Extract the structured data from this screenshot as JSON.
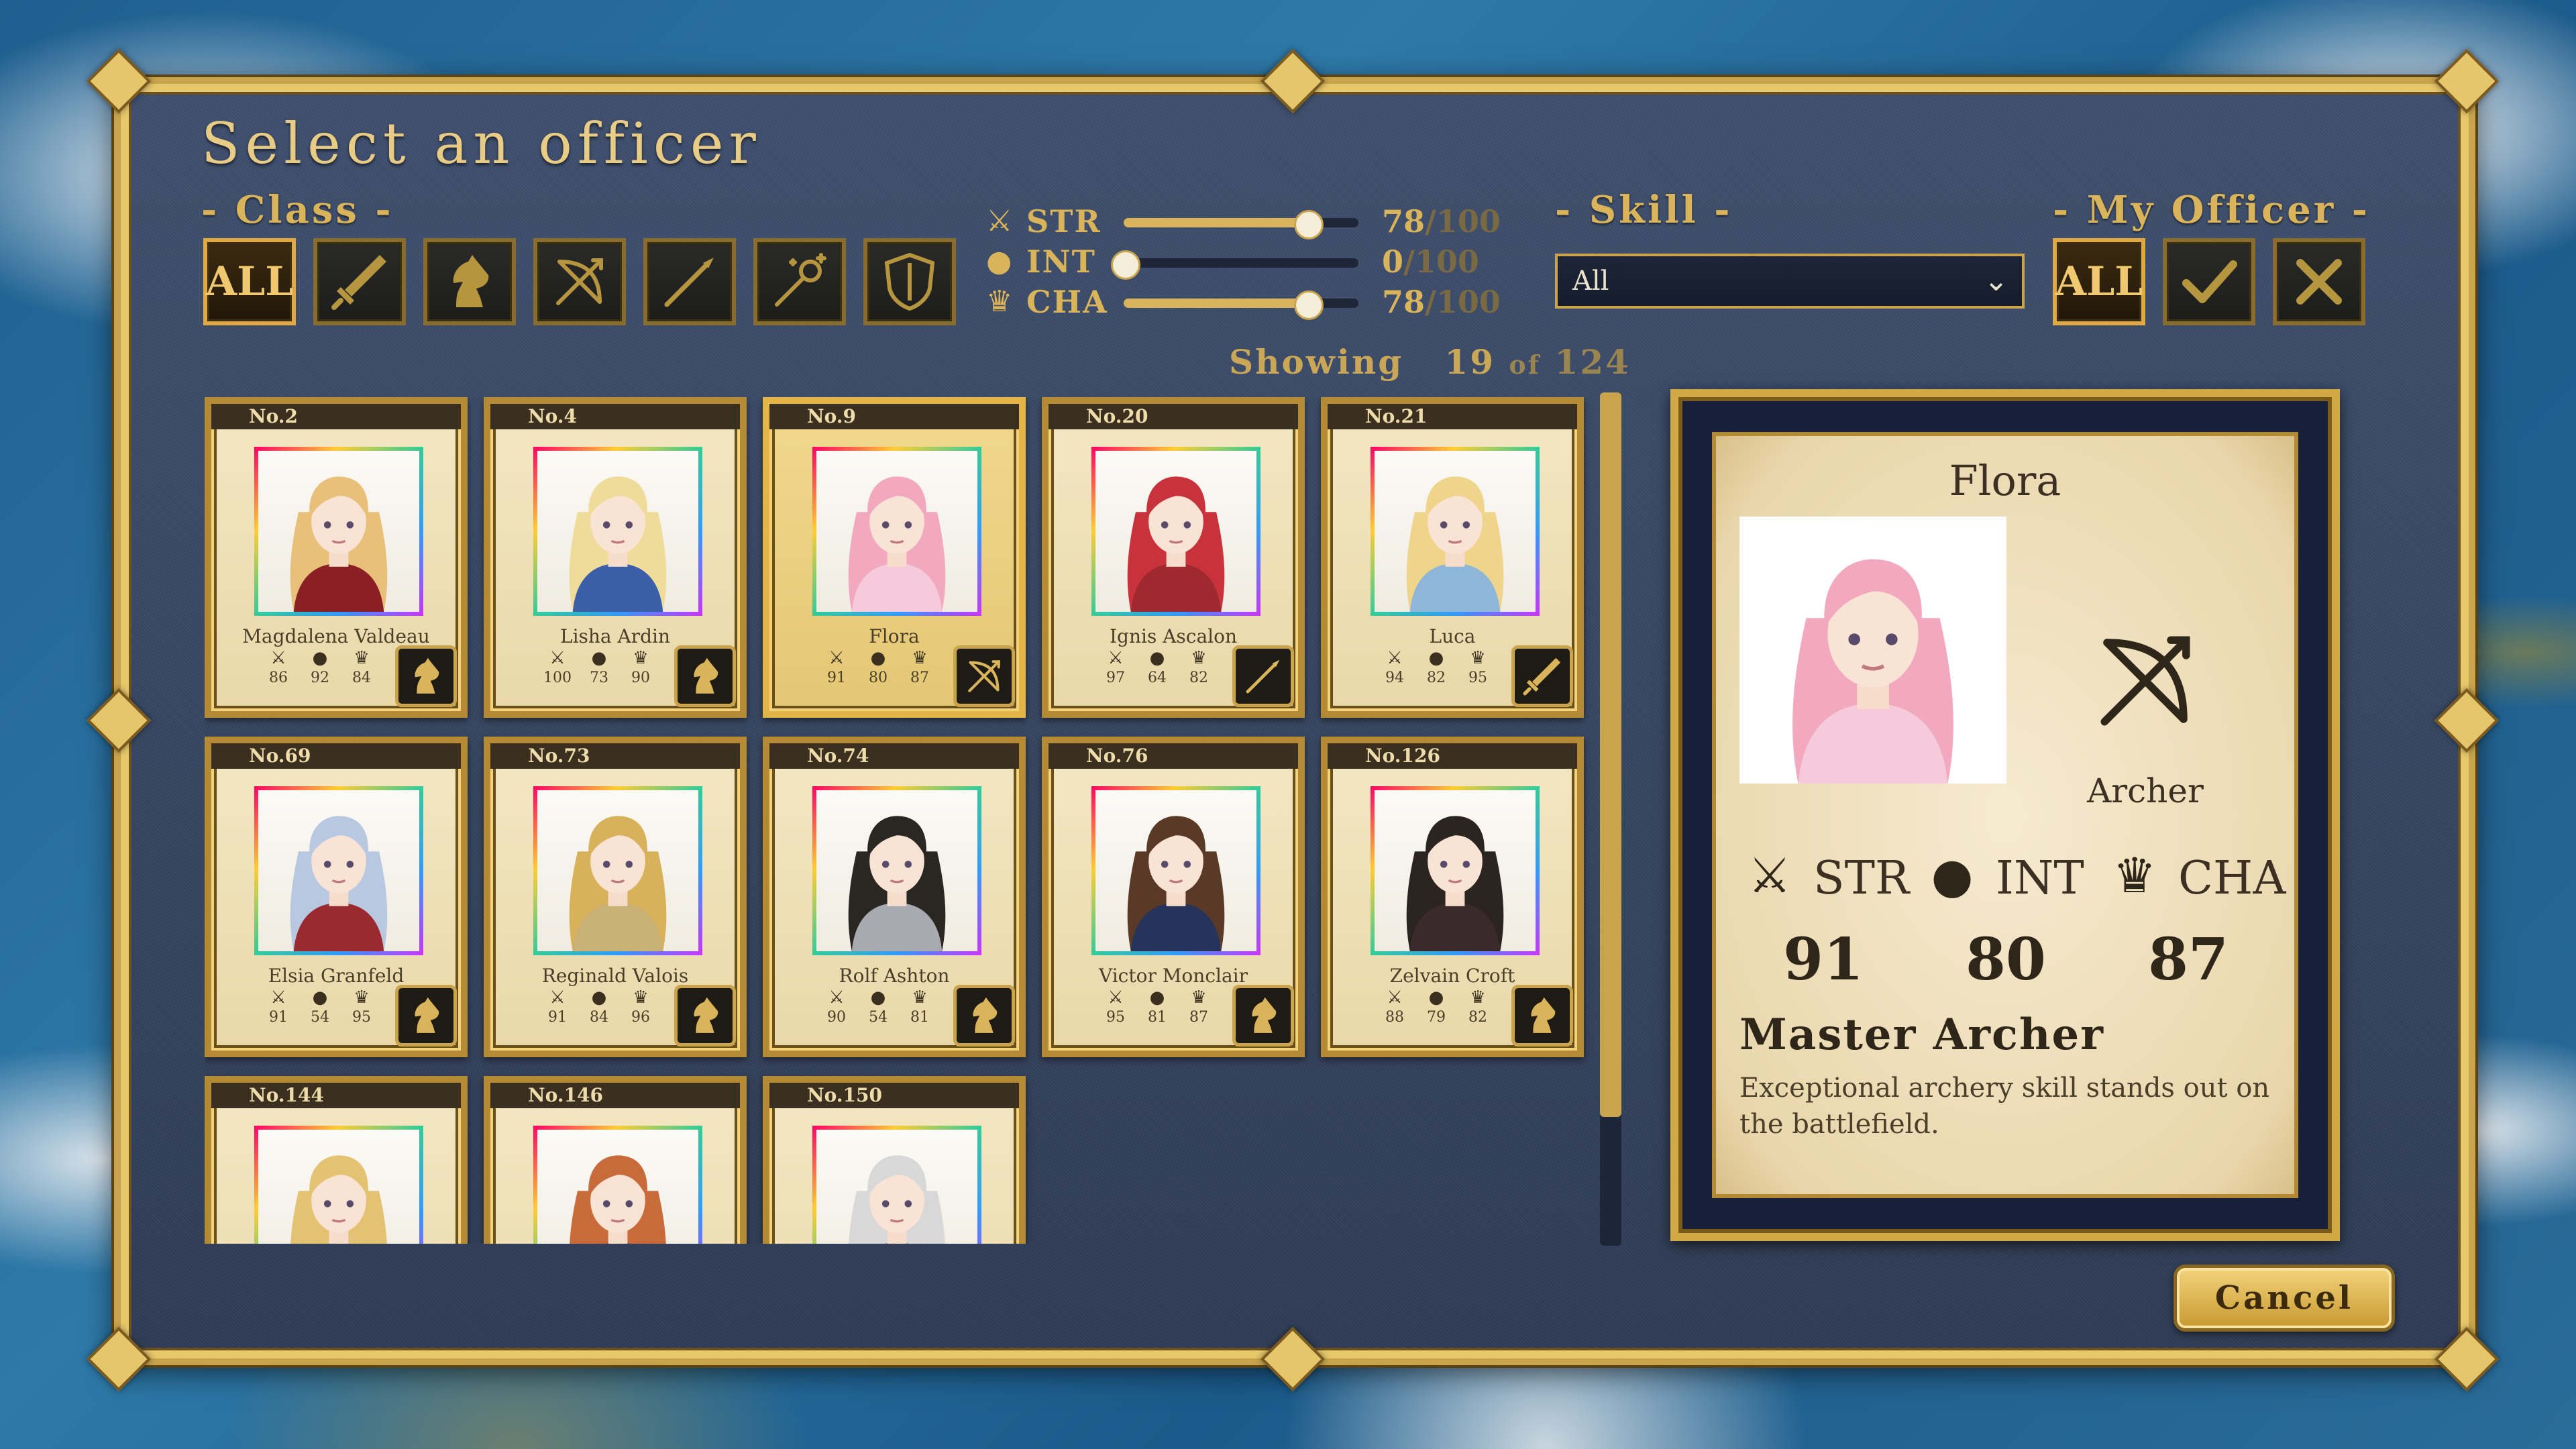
{
  "title": "Select an officer",
  "class_filter": {
    "label": "- Class -",
    "buttons": [
      {
        "label": "ALL",
        "icon": "all-text",
        "active": true
      },
      {
        "label": "",
        "icon": "sword-icon",
        "active": false
      },
      {
        "label": "",
        "icon": "knight-horse-icon",
        "active": false
      },
      {
        "label": "",
        "icon": "bow-icon",
        "active": false
      },
      {
        "label": "",
        "icon": "spear-icon",
        "active": false
      },
      {
        "label": "",
        "icon": "magic-staff-icon",
        "active": false
      },
      {
        "label": "",
        "icon": "shield-icon",
        "active": false
      }
    ]
  },
  "stat_sliders": [
    {
      "name": "STR",
      "icon": "sword-icon",
      "value": 78,
      "max": "100",
      "slash": "/"
    },
    {
      "name": "INT",
      "icon": "orb-icon",
      "value": 0,
      "max": "100",
      "slash": "/"
    },
    {
      "name": "CHA",
      "icon": "crown-icon",
      "value": 78,
      "max": "100",
      "slash": "/"
    }
  ],
  "skill_filter": {
    "label": "- Skill -",
    "selected": "All"
  },
  "my_officer_filter": {
    "label": "- My Officer -",
    "buttons": [
      {
        "label": "ALL",
        "icon": "all-text",
        "active": true
      },
      {
        "label": "",
        "icon": "check-icon",
        "active": false
      },
      {
        "label": "",
        "icon": "x-icon",
        "active": false
      }
    ]
  },
  "showing": {
    "label": "Showing",
    "count": "19",
    "of": "of",
    "total": "124"
  },
  "stat_icons": {
    "str": "⚔",
    "int": "●",
    "cha": "♛"
  },
  "officers": [
    {
      "no": "No.2",
      "name": "Magdalena Valdeau",
      "str": "86",
      "int": "92",
      "cha": "84",
      "class": "knight",
      "hair": "#e8c07a",
      "outfit": "#8a1f24",
      "selected": false
    },
    {
      "no": "No.4",
      "name": "Lisha Ardin",
      "str": "100",
      "int": "73",
      "cha": "90",
      "class": "knight",
      "hair": "#f0dc9a",
      "outfit": "#3a5fa8",
      "selected": false
    },
    {
      "no": "No.9",
      "name": "Flora",
      "str": "91",
      "int": "80",
      "cha": "87",
      "class": "archer",
      "hair": "#f2a9bf",
      "outfit": "#f6cadb",
      "selected": true
    },
    {
      "no": "No.20",
      "name": "Ignis Ascalon",
      "str": "97",
      "int": "64",
      "cha": "82",
      "class": "spear",
      "hair": "#c8323a",
      "outfit": "#9e2a30",
      "selected": false
    },
    {
      "no": "No.21",
      "name": "Luca",
      "str": "94",
      "int": "82",
      "cha": "95",
      "class": "sword",
      "hair": "#efd58c",
      "outfit": "#8fb6d8",
      "selected": false
    },
    {
      "no": "No.69",
      "name": "Elsia Granfeld",
      "str": "91",
      "int": "54",
      "cha": "95",
      "class": "knight",
      "hair": "#b8c8e0",
      "outfit": "#9a2a30",
      "selected": false
    },
    {
      "no": "No.73",
      "name": "Reginald Valois",
      "str": "91",
      "int": "84",
      "cha": "96",
      "class": "knight",
      "hair": "#d8b25a",
      "outfit": "#c9b075",
      "selected": false
    },
    {
      "no": "No.74",
      "name": "Rolf Ashton",
      "str": "90",
      "int": "54",
      "cha": "81",
      "class": "knight",
      "hair": "#2a2622",
      "outfit": "#a9a9b1",
      "selected": false
    },
    {
      "no": "No.76",
      "name": "Victor Monclair",
      "str": "95",
      "int": "81",
      "cha": "87",
      "class": "knight",
      "hair": "#5a3a26",
      "outfit": "#26345c",
      "selected": false
    },
    {
      "no": "No.126",
      "name": "Zelvain Croft",
      "str": "88",
      "int": "79",
      "cha": "82",
      "class": "knight",
      "hair": "#2c2420",
      "outfit": "#3a2a2e",
      "selected": false
    },
    {
      "no": "No.144",
      "name": "",
      "str": "",
      "int": "",
      "cha": "",
      "class": "",
      "hair": "#e3c272",
      "outfit": "#b8b8c0",
      "selected": false
    },
    {
      "no": "No.146",
      "name": "",
      "str": "",
      "int": "",
      "cha": "",
      "class": "",
      "hair": "#c86a3a",
      "outfit": "#2a2a40",
      "selected": false
    },
    {
      "no": "No.150",
      "name": "",
      "str": "",
      "int": "",
      "cha": "",
      "class": "",
      "hair": "#d8d8d8",
      "outfit": "#3a3a3a",
      "selected": false
    }
  ],
  "detail": {
    "name": "Flora",
    "class_label": "Archer",
    "stats": [
      {
        "label": "STR",
        "value": "91",
        "icon": "sword-icon"
      },
      {
        "label": "INT",
        "value": "80",
        "icon": "orb-icon"
      },
      {
        "label": "CHA",
        "value": "87",
        "icon": "crown-icon"
      }
    ],
    "skill_name": "Master Archer",
    "skill_desc": "Exceptional archery skill stands out on the battlefield."
  },
  "cancel_label": "Cancel",
  "colors": {
    "gold": "#d9b45a",
    "panel": "#3f4f6e",
    "parchment": "#f3e7c4"
  }
}
